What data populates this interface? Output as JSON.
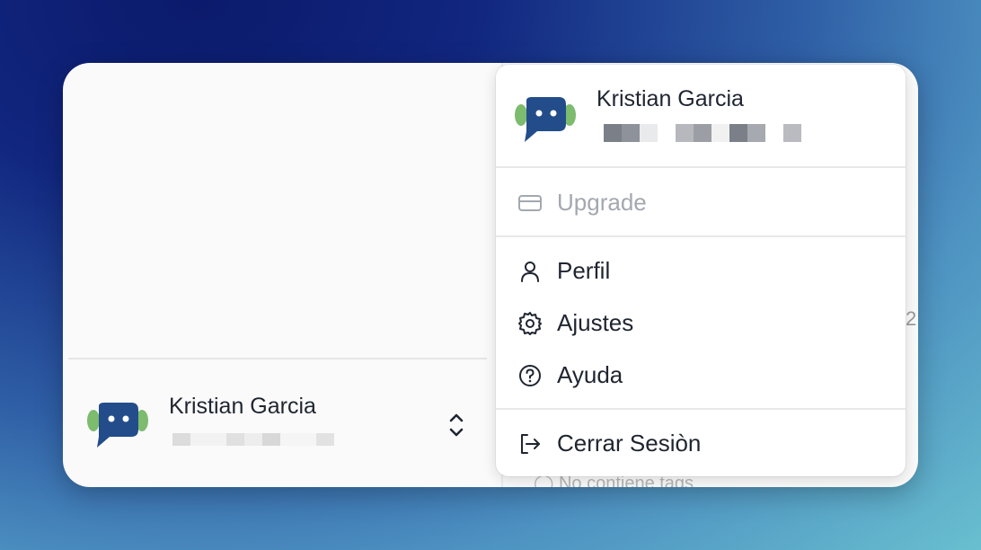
{
  "sidebar_user": {
    "name": "Kristian Garcia"
  },
  "menu": {
    "header_name": "Kristian Garcia",
    "items": [
      {
        "label": "Upgrade",
        "icon": "credit-card-icon",
        "disabled": true
      },
      {
        "label": "Perfil",
        "icon": "user-icon"
      },
      {
        "label": "Ajustes",
        "icon": "gear-icon"
      },
      {
        "label": "Ayuda",
        "icon": "help-circle-icon"
      },
      {
        "label": "Cerrar Sesiòn",
        "icon": "logout-icon"
      }
    ]
  },
  "background": {
    "tags_text": "No contiene tags",
    "partial_digit": "2"
  },
  "colors": {
    "avatar_bubble": "#234d8a",
    "avatar_ears": "#7dbb6e",
    "text": "#1f2530",
    "muted": "#a3a8b0"
  }
}
